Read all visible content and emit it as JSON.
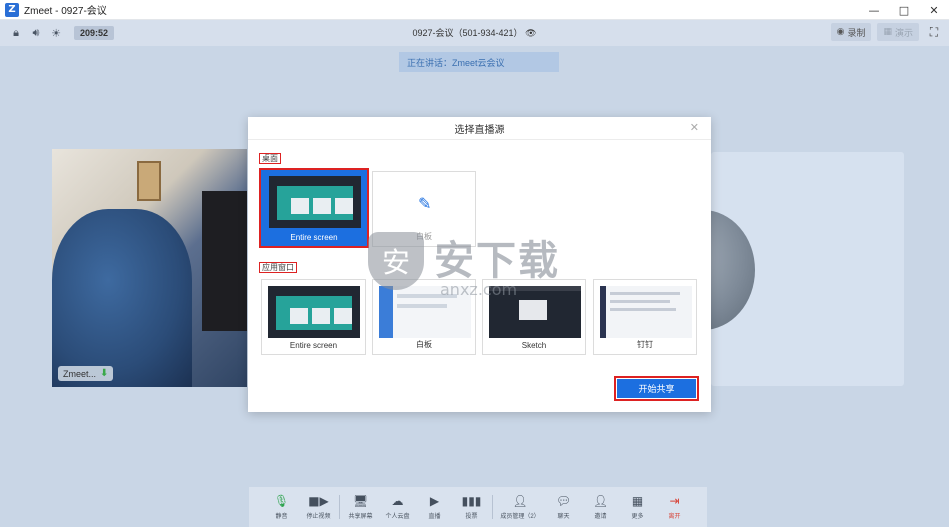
{
  "window": {
    "app_initial": "Z",
    "title": "Zmeet - 0927-会议",
    "min": "—",
    "max": "□",
    "close": "✕"
  },
  "topbar": {
    "timer": "209:52",
    "meeting": "0927-会议（501-934-421）",
    "record": "录制",
    "split": "演示"
  },
  "speaking": "正在讲话：Zmeet云会议",
  "video": {
    "name": "Zmeet..."
  },
  "modal": {
    "title": "选择直播源",
    "desktop_label": "桌面",
    "app_label": "应用窗口",
    "start_button": "开始共享",
    "desktop_sources": [
      {
        "caption": "Entire screen",
        "selected": true
      },
      {
        "caption": "白板",
        "selected": false
      }
    ],
    "app_sources": [
      {
        "caption": "Entire screen"
      },
      {
        "caption": "白板"
      },
      {
        "caption": "Sketch"
      },
      {
        "caption": "钉钉"
      }
    ]
  },
  "watermark": {
    "text": "安下载",
    "sub": "anxz.com"
  },
  "toolbar": {
    "mute": "静音",
    "stop_video": "停止视频",
    "share_screen": "共享屏幕",
    "personal": "个人云盘",
    "live": "直播",
    "vote": "投票",
    "members": "成员管理（2）",
    "chat": "聊天",
    "invite": "邀请",
    "more": "更多",
    "leave": "离开"
  },
  "colors": {
    "accent": "#1c6fe0",
    "highlight": "#dd2222",
    "leave": "#d8453a"
  }
}
